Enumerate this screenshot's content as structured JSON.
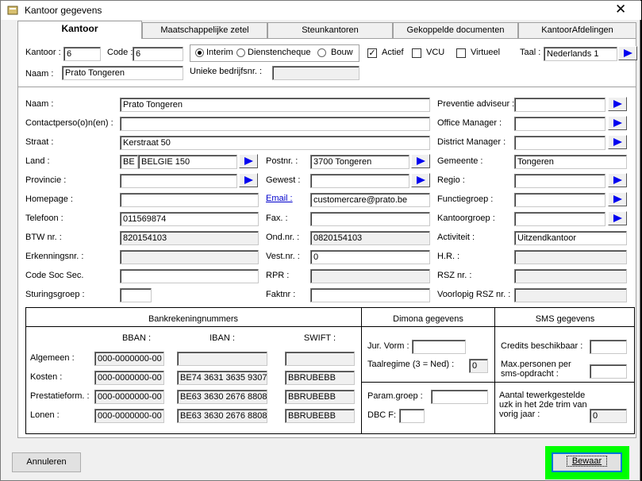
{
  "window": {
    "title": "Kantoor gegevens",
    "close": "✕"
  },
  "tabs": [
    "Kantoor",
    "Maatschappelijke zetel",
    "Steunkantoren",
    "Gekoppelde documenten",
    "KantoorAfdelingen"
  ],
  "top": {
    "kantoor_label": "Kantoor :",
    "kantoor_value": "6",
    "code_label": "Code :",
    "code_value": "6",
    "naam_label": "Naam :",
    "naam_value": "Prato Tongeren",
    "unieke_label": "Unieke bedrijfsnr. :",
    "unieke_value": "",
    "type_options": [
      "Interim",
      "Dienstencheque",
      "Bouw"
    ],
    "type_selected": "Interim",
    "actief_label": "Actief",
    "actief": true,
    "vcu_label": "VCU",
    "vcu": false,
    "virtueel_label": "Virtueel",
    "virtueel": false,
    "taal_label": "Taal :",
    "taal_value": "Nederlands 1"
  },
  "details": {
    "naam_label": "Naam :",
    "naam_value": "Prato Tongeren",
    "contact_label": "Contactperso(o)n(en) :",
    "contact_value": "",
    "straat_label": "Straat :",
    "straat_value": "Kerstraat 50",
    "land_label": "Land :",
    "land_code": "BE",
    "land_name": "BELGIE 150",
    "provincie_label": "Provincie :",
    "provincie_value": "",
    "homepage_label": "Homepage :",
    "homepage_value": "",
    "telefoon_label": "Telefoon :",
    "telefoon_value": "011569874",
    "btw_label": "BTW nr. :",
    "btw_value": "820154103",
    "erkenning_label": "Erkenningsnr. :",
    "erkenning_value": "",
    "codesoc_label": "Code Soc Sec.",
    "codesoc_value": "",
    "sturing_label": "Sturingsgroep :",
    "sturing_value": "",
    "postnr_label": "Postnr. :",
    "postnr_value": "3700 Tongeren",
    "gewest_label": "Gewest :",
    "gewest_value": "",
    "email_label": "Email :",
    "email_value": "customercare@prato.be",
    "fax_label": "Fax. :",
    "fax_value": "",
    "ondnr_label": "Ond.nr. :",
    "ondnr_value": "0820154103",
    "vestnr_label": "Vest.nr. :",
    "vestnr_value": "0",
    "rpr_label": "RPR :",
    "rpr_value": "",
    "faktnr_label": "Faktnr :",
    "faktnr_value": "",
    "preventie_label": "Preventie adviseur :",
    "preventie_value": "",
    "office_label": "Office Manager :",
    "office_value": "",
    "district_label": "District Manager :",
    "district_value": "",
    "gemeente_label": "Gemeente :",
    "gemeente_value": "Tongeren",
    "regio_label": "Regio :",
    "regio_value": "",
    "functie_label": "Functiegroep :",
    "functie_value": "",
    "kantoorgroep_label": "Kantoorgroep :",
    "kantoorgroep_value": "",
    "activiteit_label": "Activiteit :",
    "activiteit_value": "Uitzendkantoor",
    "hr_label": "H.R. :",
    "hr_value": "",
    "rsz_label": "RSZ nr. :",
    "rsz_value": "",
    "voorlopig_label": "Voorlopig RSZ nr. :",
    "voorlopig_value": ""
  },
  "bank": {
    "title": "Bankrekeningnummers",
    "col_bban": "BBAN :",
    "col_iban": "IBAN :",
    "col_swift": "SWIFT :",
    "rows": [
      {
        "label": "Algemeen :",
        "bban": "000-0000000-00",
        "iban": "",
        "swift": ""
      },
      {
        "label": "Kosten :",
        "bban": "000-0000000-00",
        "iban": "BE74 3631 3635 9307",
        "swift": "BBRUBEBB"
      },
      {
        "label": "Prestatieform. :",
        "bban": "000-0000000-00",
        "iban": "BE63 3630 2676 8808",
        "swift": "BBRUBEBB"
      },
      {
        "label": "Lonen :",
        "bban": "000-0000000-00",
        "iban": "BE63 3630 2676 8808",
        "swift": "BBRUBEBB"
      }
    ]
  },
  "dimona": {
    "title": "Dimona gegevens",
    "jur_label": "Jur. Vorm :",
    "jur_value": "",
    "taal_label": "Taalregime (3 = Ned) :",
    "taal_value": "0",
    "param_label": "Param.groep :",
    "param_value": "",
    "dbc_label": "DBC F:",
    "dbc_value": ""
  },
  "sms": {
    "title": "SMS gegevens",
    "credits_label": "Credits beschikbaar :",
    "credits_value": "",
    "max_label1": "Max.personen per",
    "max_label2": "sms-opdracht :",
    "max_value": "",
    "aantal_label1": "Aantal tewerkgestelde",
    "aantal_label2": "uzk in het 2de trim van",
    "aantal_label3": "vorig jaar :",
    "aantal_value": "0"
  },
  "buttons": {
    "annuleren": "Annuleren",
    "bewaar": "Bewaar"
  },
  "colors": {
    "focus_highlight": "#00ff00",
    "arrow": "#0000f0"
  }
}
